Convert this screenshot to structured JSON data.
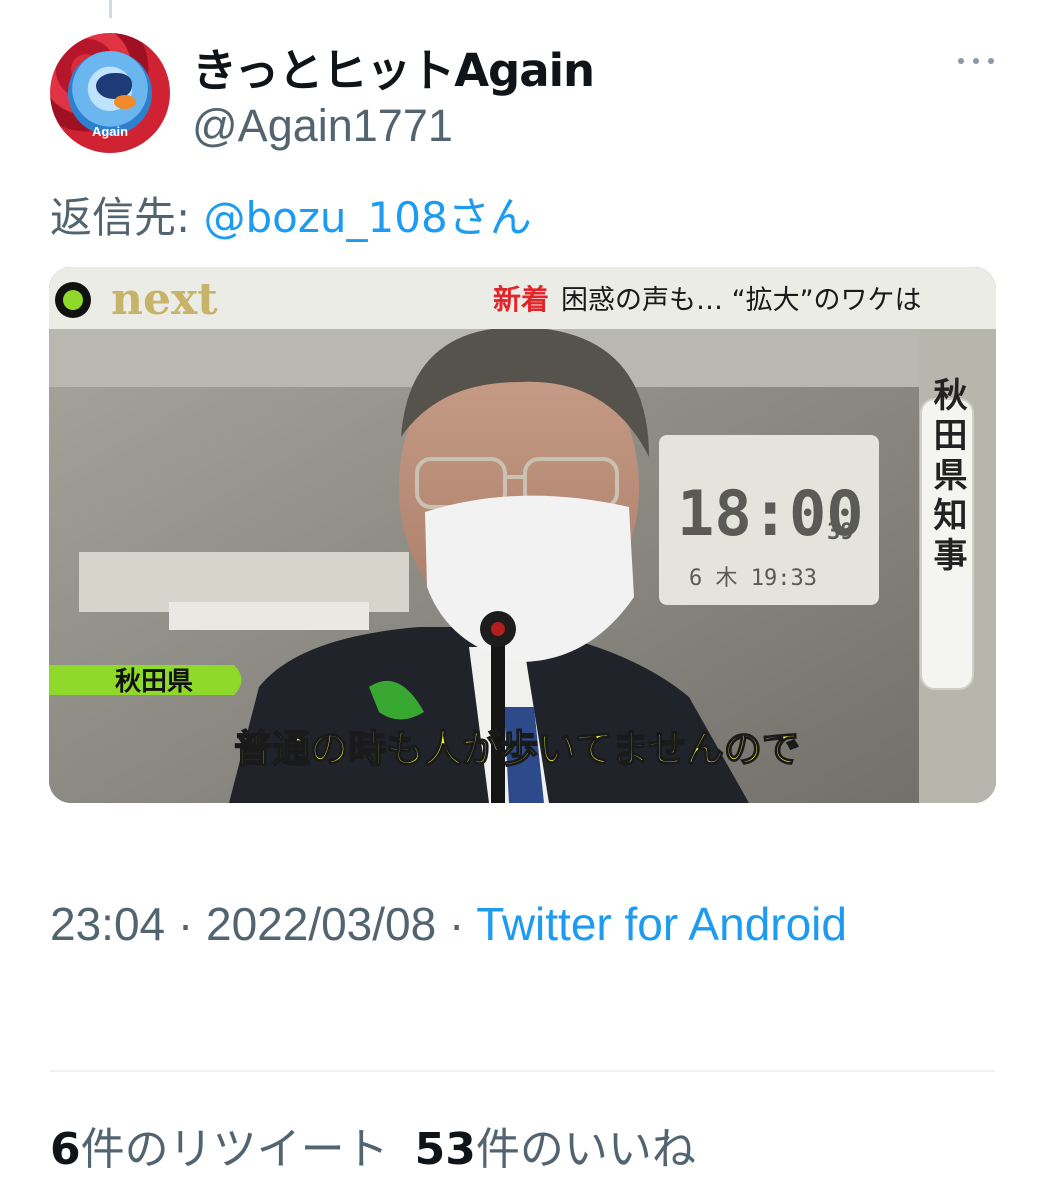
{
  "tweet": {
    "display_name": "きっとヒットAgain",
    "handle": "@Again1771",
    "avatar_text": "Again",
    "reply": {
      "prefix": "返信先: ",
      "mention": "@bozu_108さん"
    },
    "media": {
      "program_logo": "next",
      "headline_tag": "新着",
      "headline": "困惑の声も… “拡大”のワケは",
      "location_label": "秋田県",
      "title_label": "秋田県知事",
      "subtitle": "普通の時も人が歩いてませんので",
      "clock_time": "18:00",
      "clock_seconds": "39",
      "clock_sub": "6 木  19:33"
    },
    "timestamp": {
      "time_date": "23:04 · 2022/03/08 · ",
      "source": "Twitter for Android"
    },
    "stats": {
      "retweets_count": "6",
      "retweets_label": "件のリツイート",
      "likes_count": "53",
      "likes_label": "件のいいね"
    }
  },
  "icons": {
    "more": "more-options-icon"
  },
  "colors": {
    "accent": "#1d9bf0",
    "secondary_text": "#536471",
    "headline_tag": "#e0262a",
    "logo_green": "#8fd92b",
    "subtitle_yellow": "#f3f23a"
  }
}
